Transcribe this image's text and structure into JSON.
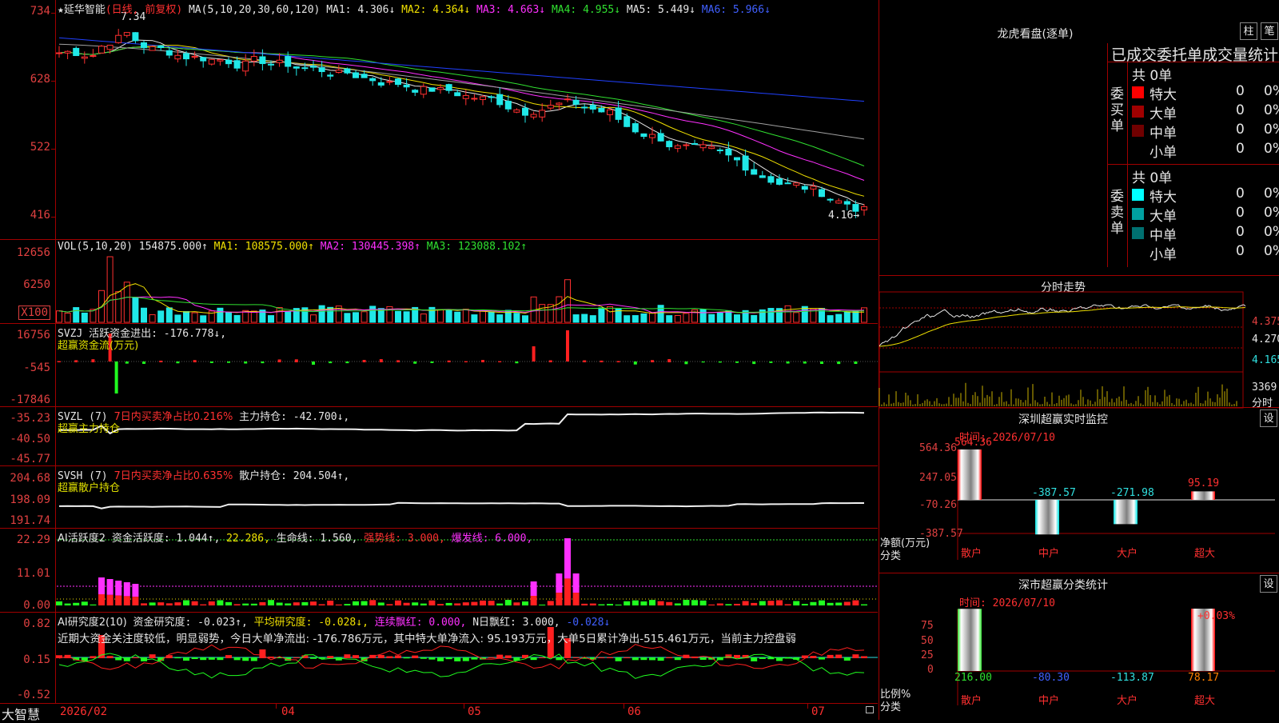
{
  "stock": {
    "name": "延华智能",
    "period": "(日线, 前复权)",
    "star": "★"
  },
  "ma_legend": {
    "label": "MA(5,10,20,30,60,120)",
    "ma1": "MA1: 4.306↓",
    "ma2": "MA2: 4.364↓",
    "ma3": "MA3: 4.663↓",
    "ma4": "MA4: 4.955↓",
    "ma5": "MA5: 5.449↓",
    "ma6": "MA6: 5.966↓"
  },
  "price_axis": [
    "734",
    "628",
    "522",
    "416"
  ],
  "price_marks": {
    "high": "7.34",
    "low": "4.16→"
  },
  "vol_legend": {
    "label": "VOL(5,10,20)",
    "value": "154875.000↑",
    "ma1": "MA1: 108575.000↑",
    "ma2": "MA2: 130445.398↑",
    "ma3": "MA3: 123088.102↑"
  },
  "vol_axis": [
    "12656",
    "6250",
    "X100"
  ],
  "svzj": {
    "title": "SVZJ",
    "line1": "活跃资金进出: -176.778↓,",
    "line2": "超赢资金流(万元)",
    "axis": [
      "16756",
      "-545",
      "-17846"
    ]
  },
  "svzl": {
    "title": "SVZL (7)",
    "pct": "7日内买卖净占比0.216%",
    "hold": "主力持仓: -42.700↓,",
    "line2": "超赢主力持仓",
    "axis": [
      "-35.23",
      "-40.50",
      "-45.77"
    ]
  },
  "svsh": {
    "title": "SVSH (7)",
    "pct": "7日内买卖净占比0.635%",
    "hold": "散户持仓: 204.504↑,",
    "line2": "超赢散户持仓",
    "axis": [
      "204.68",
      "198.09",
      "191.74"
    ]
  },
  "ai1": {
    "title": "AI活跃度2",
    "a": "资金活跃度: 1.044↑,",
    "b": "22.286,",
    "c": "生命线: 1.560,",
    "d": "强势线: 3.000,",
    "e": "爆发线: 6.000,",
    "axis": [
      "22.29",
      "11.01",
      "0.00"
    ]
  },
  "ai2": {
    "title": "AI研究度2(10)",
    "a": "资金研究度: -0.023↑,",
    "b": "平均研究度: -0.028↓,",
    "c": "连续飘红: 0.000,",
    "d": "N日飘红: 3.000,",
    "e": "-0.028↓",
    "desc": "近期大资金关注度较低，明显弱势，今日大单净流出: -176.786万元，其中特大单净流入: 95.193万元，大单5日累计净出-515.461万元，当前主力控盘弱",
    "axis": [
      "0.82",
      "0.15",
      "-0.52"
    ]
  },
  "footer": {
    "brand": "大智慧",
    "dates": [
      "2026/02",
      "04",
      "05",
      "06",
      "07"
    ]
  },
  "dragon": {
    "title": "龙虎看盘(逐单)",
    "btn1": "柱",
    "btn2": "笔",
    "subtitle": "已成交委托单成交量统计",
    "buy": {
      "label": "委买单",
      "total": "共 0单",
      "rows": [
        {
          "name": "特大",
          "v": "0",
          "p": "0%"
        },
        {
          "name": "大单",
          "v": "0",
          "p": "0%"
        },
        {
          "name": "中单",
          "v": "0",
          "p": "0%"
        },
        {
          "name": "小单",
          "v": "0",
          "p": "0%"
        }
      ]
    },
    "sell": {
      "label": "委卖单",
      "total": "共 0单",
      "rows": [
        {
          "name": "特大",
          "v": "0",
          "p": "0%"
        },
        {
          "name": "大单",
          "v": "0",
          "p": "0%"
        },
        {
          "name": "中单",
          "v": "0",
          "p": "0%"
        },
        {
          "name": "小单",
          "v": "0",
          "p": "0%"
        }
      ]
    },
    "colors": {
      "buy": [
        "#ff0000",
        "#a00000",
        "#700000",
        "#000000"
      ],
      "sell": [
        "#00ffff",
        "#00a0a0",
        "#007070",
        "#000000"
      ]
    }
  },
  "intraday": {
    "title": "分时走势",
    "axis": [
      "4.375",
      "4.270",
      "4.165"
    ],
    "vol": "3369",
    "vol_label": "分时"
  },
  "sz_monitor": {
    "title": "深圳超赢实时监控",
    "btn": "设",
    "time": "时间: 2026/07/10",
    "axis": [
      "564.36",
      "247.05",
      "-70.26",
      "-387.57"
    ],
    "ylabel": "净额(万元)",
    "xlabel": "分类",
    "bars": [
      {
        "name": "散户",
        "value": "564.36"
      },
      {
        "name": "中户",
        "value": "-387.57"
      },
      {
        "name": "大户",
        "value": "-271.98"
      },
      {
        "name": "超大",
        "value": "95.19"
      }
    ]
  },
  "sz_class": {
    "title": "深市超赢分类统计",
    "btn": "设",
    "time": "时间: 2026/07/10",
    "axis": [
      "75",
      "50",
      "25",
      "0"
    ],
    "ylabel": "比例%",
    "xlabel": "分类",
    "top": "+0.03%",
    "bars": [
      {
        "name": "散户",
        "value": "216.00"
      },
      {
        "name": "中户",
        "value": "-80.30"
      },
      {
        "name": "大户",
        "value": "-113.87"
      },
      {
        "name": "超大",
        "value": "78.17"
      }
    ]
  }
}
